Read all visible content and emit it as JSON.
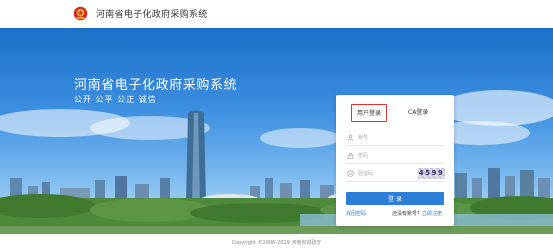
{
  "header": {
    "site_title": "河南省电子化政府采购系统"
  },
  "hero": {
    "title": "河南省电子化政府采购系统",
    "slogan": "公开  公平  公正  诚信"
  },
  "login": {
    "tab_user": "用户登录",
    "tab_ca": "CA登录",
    "account_placeholder": "账号",
    "password_placeholder": "密码",
    "captcha_placeholder": "验证码",
    "captcha_code": "4599",
    "submit_label": "登 录",
    "forgot_link": "找回密码",
    "no_account_text": "还没有账号？",
    "register_link": "立即注册"
  },
  "footer": {
    "copyright": "Copyright ©2006-2019 河南省财政厅"
  },
  "colors": {
    "accent": "#2d7ed8",
    "active_tab_border": "#e8312a"
  }
}
